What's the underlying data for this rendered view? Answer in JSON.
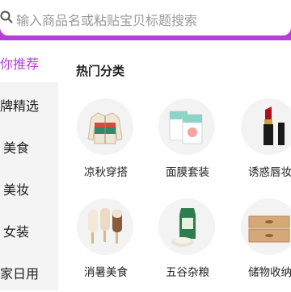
{
  "search": {
    "placeholder": "输入商品名或粘贴宝贝标题搜索"
  },
  "sidebar": {
    "items": [
      {
        "label": "为你推荐",
        "active": true
      },
      {
        "label": "品牌精选"
      },
      {
        "label": "美食"
      },
      {
        "label": "美妆"
      },
      {
        "label": "女装"
      },
      {
        "label": "居家日用"
      }
    ]
  },
  "main": {
    "section_title": "热门分类",
    "categories": [
      {
        "label": "凉秋穿搭",
        "icon": "jacket-icon"
      },
      {
        "label": "面膜套装",
        "icon": "face-mask-icon"
      },
      {
        "label": "诱惑唇妆",
        "icon": "lipstick-icon"
      },
      {
        "label": "消暑美食",
        "icon": "popsicle-icon"
      },
      {
        "label": "五谷杂粮",
        "icon": "rice-bag-icon"
      },
      {
        "label": "储物收纳",
        "icon": "storage-box-icon"
      }
    ]
  },
  "colors": {
    "accent": "#b53fd8",
    "sidebar_bg": "#f4f4f4"
  }
}
